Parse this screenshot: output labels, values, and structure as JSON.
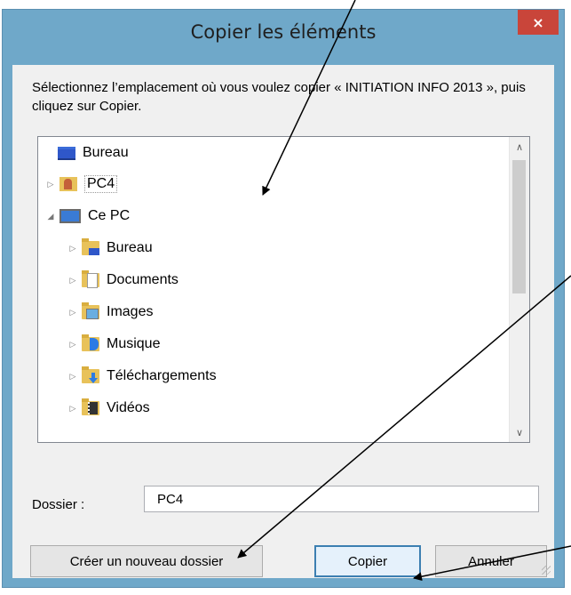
{
  "dialog": {
    "title": "Copier les éléments",
    "close_glyph": "×",
    "instructions": "Sélectionnez l’emplacement où vous voulez copier « INITIATION INFO 2013 », puis cliquez sur Copier."
  },
  "tree": {
    "items": [
      {
        "label": "Bureau",
        "icon": "desktop-icon",
        "expander": ""
      },
      {
        "label": "PC4",
        "icon": "user-folder-icon",
        "expander": "▷"
      },
      {
        "label": "Ce PC",
        "icon": "computer-icon",
        "expander": "◢"
      },
      {
        "label": "Bureau",
        "icon": "desktop-folder-icon",
        "expander": "▷"
      },
      {
        "label": "Documents",
        "icon": "documents-folder-icon",
        "expander": "▷"
      },
      {
        "label": "Images",
        "icon": "pictures-folder-icon",
        "expander": "▷"
      },
      {
        "label": "Musique",
        "icon": "music-folder-icon",
        "expander": "▷"
      },
      {
        "label": "Téléchargements",
        "icon": "downloads-folder-icon",
        "expander": "▷"
      },
      {
        "label": "Vidéos",
        "icon": "videos-folder-icon",
        "expander": "▷"
      }
    ],
    "scroll_up_glyph": "∧",
    "scroll_down_glyph": "∨"
  },
  "folder": {
    "label": "Dossier :",
    "value": "PC4"
  },
  "buttons": {
    "new_folder": "Créer un nouveau dossier",
    "copy": "Copier",
    "cancel": "Annuler"
  },
  "colors": {
    "window_frame": "#6fa8c9",
    "close_button": "#c9453a",
    "annotation_arrows": "#000000"
  }
}
